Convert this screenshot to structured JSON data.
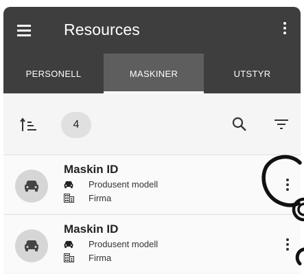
{
  "app": {
    "title": "Resources"
  },
  "tabs": [
    {
      "label": "PERSONELL",
      "selected": false
    },
    {
      "label": "MASKINER",
      "selected": true
    },
    {
      "label": "UTSTYR",
      "selected": false
    }
  ],
  "toolbar": {
    "count": "4"
  },
  "items": [
    {
      "title": "Maskin ID",
      "model": "Produsent modell",
      "company": "Firma"
    },
    {
      "title": "Maskin ID",
      "model": "Produsent modell",
      "company": "Firma"
    }
  ],
  "icons": {
    "menu": "menu-icon",
    "more": "more-vertical-icon",
    "sort": "sort-icon",
    "search": "search-icon",
    "filter": "filter-icon",
    "car": "car-icon",
    "building": "building-icon"
  },
  "colors": {
    "appbar": "#3e3e3e",
    "selected_tab": "#5e5e5e",
    "background": "#f5f5f5"
  }
}
